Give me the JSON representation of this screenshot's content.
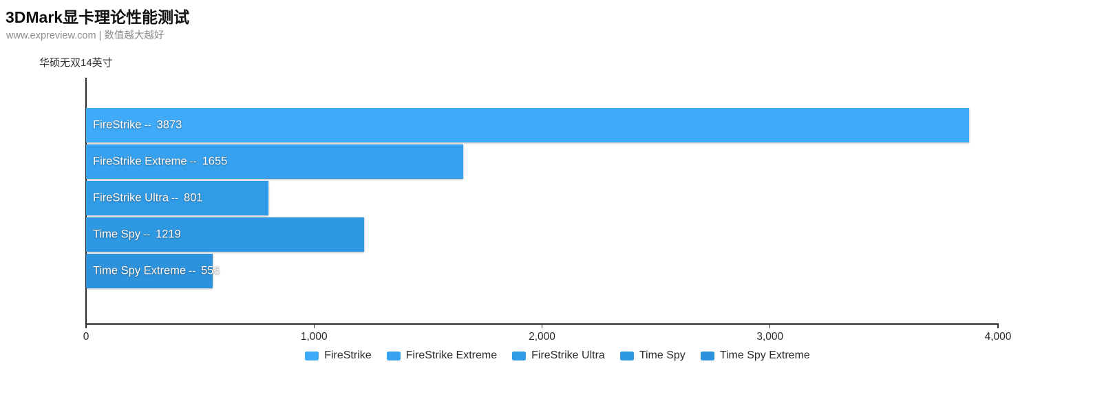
{
  "header": {
    "title": "3DMark显卡理论性能测试",
    "subtitle": "www.expreview.com | 数值越大越好"
  },
  "series_label": "华硕无双14英寸",
  "separator": "--",
  "chart_data": {
    "type": "bar",
    "orientation": "horizontal",
    "title": "3DMark显卡理论性能测试",
    "subtitle": "www.expreview.com | 数值越大越好",
    "series_name": "华硕无双14英寸",
    "xlabel": "",
    "ylabel": "",
    "xlim": [
      0,
      4000
    ],
    "grid": false,
    "legend_position": "bottom",
    "tick_labels": [
      "0",
      "1,000",
      "2,000",
      "3,000",
      "4,000"
    ],
    "tick_values": [
      0,
      1000,
      2000,
      3000,
      4000
    ],
    "categories": [
      "FireStrike",
      "FireStrike Extreme",
      "FireStrike Ultra",
      "Time Spy",
      "Time Spy Extreme"
    ],
    "values": [
      3873,
      1655,
      801,
      1219,
      556
    ],
    "value_labels": [
      "3873",
      "1655",
      "801",
      "1219",
      "556"
    ],
    "colors": [
      "#3FAAF7",
      "#36A2EF",
      "#309BE6",
      "#2E98E2",
      "#2D92DC"
    ],
    "bars": [
      {
        "label": "FireStrike",
        "value": 3873,
        "value_label": "3873",
        "color": "#3FAAF7",
        "label_outside": false
      },
      {
        "label": "FireStrike Extreme",
        "value": 1655,
        "value_label": "1655",
        "color": "#36A2EF",
        "label_outside": false
      },
      {
        "label": "FireStrike Ultra",
        "value": 801,
        "value_label": "801",
        "color": "#309BE6",
        "label_outside": false
      },
      {
        "label": "Time Spy",
        "value": 1219,
        "value_label": "1219",
        "color": "#2E98E2",
        "label_outside": false
      },
      {
        "label": "Time Spy Extreme",
        "value": 556,
        "value_label": "556",
        "color": "#2D92DC",
        "label_outside": true
      }
    ],
    "legend": [
      {
        "label": "FireStrike",
        "color": "#3FAAF7"
      },
      {
        "label": "FireStrike Extreme",
        "color": "#36A2EF"
      },
      {
        "label": "FireStrike Ultra",
        "color": "#309BE6"
      },
      {
        "label": "Time Spy",
        "color": "#2E98E2"
      },
      {
        "label": "Time Spy Extreme",
        "color": "#2D92DC"
      }
    ]
  }
}
